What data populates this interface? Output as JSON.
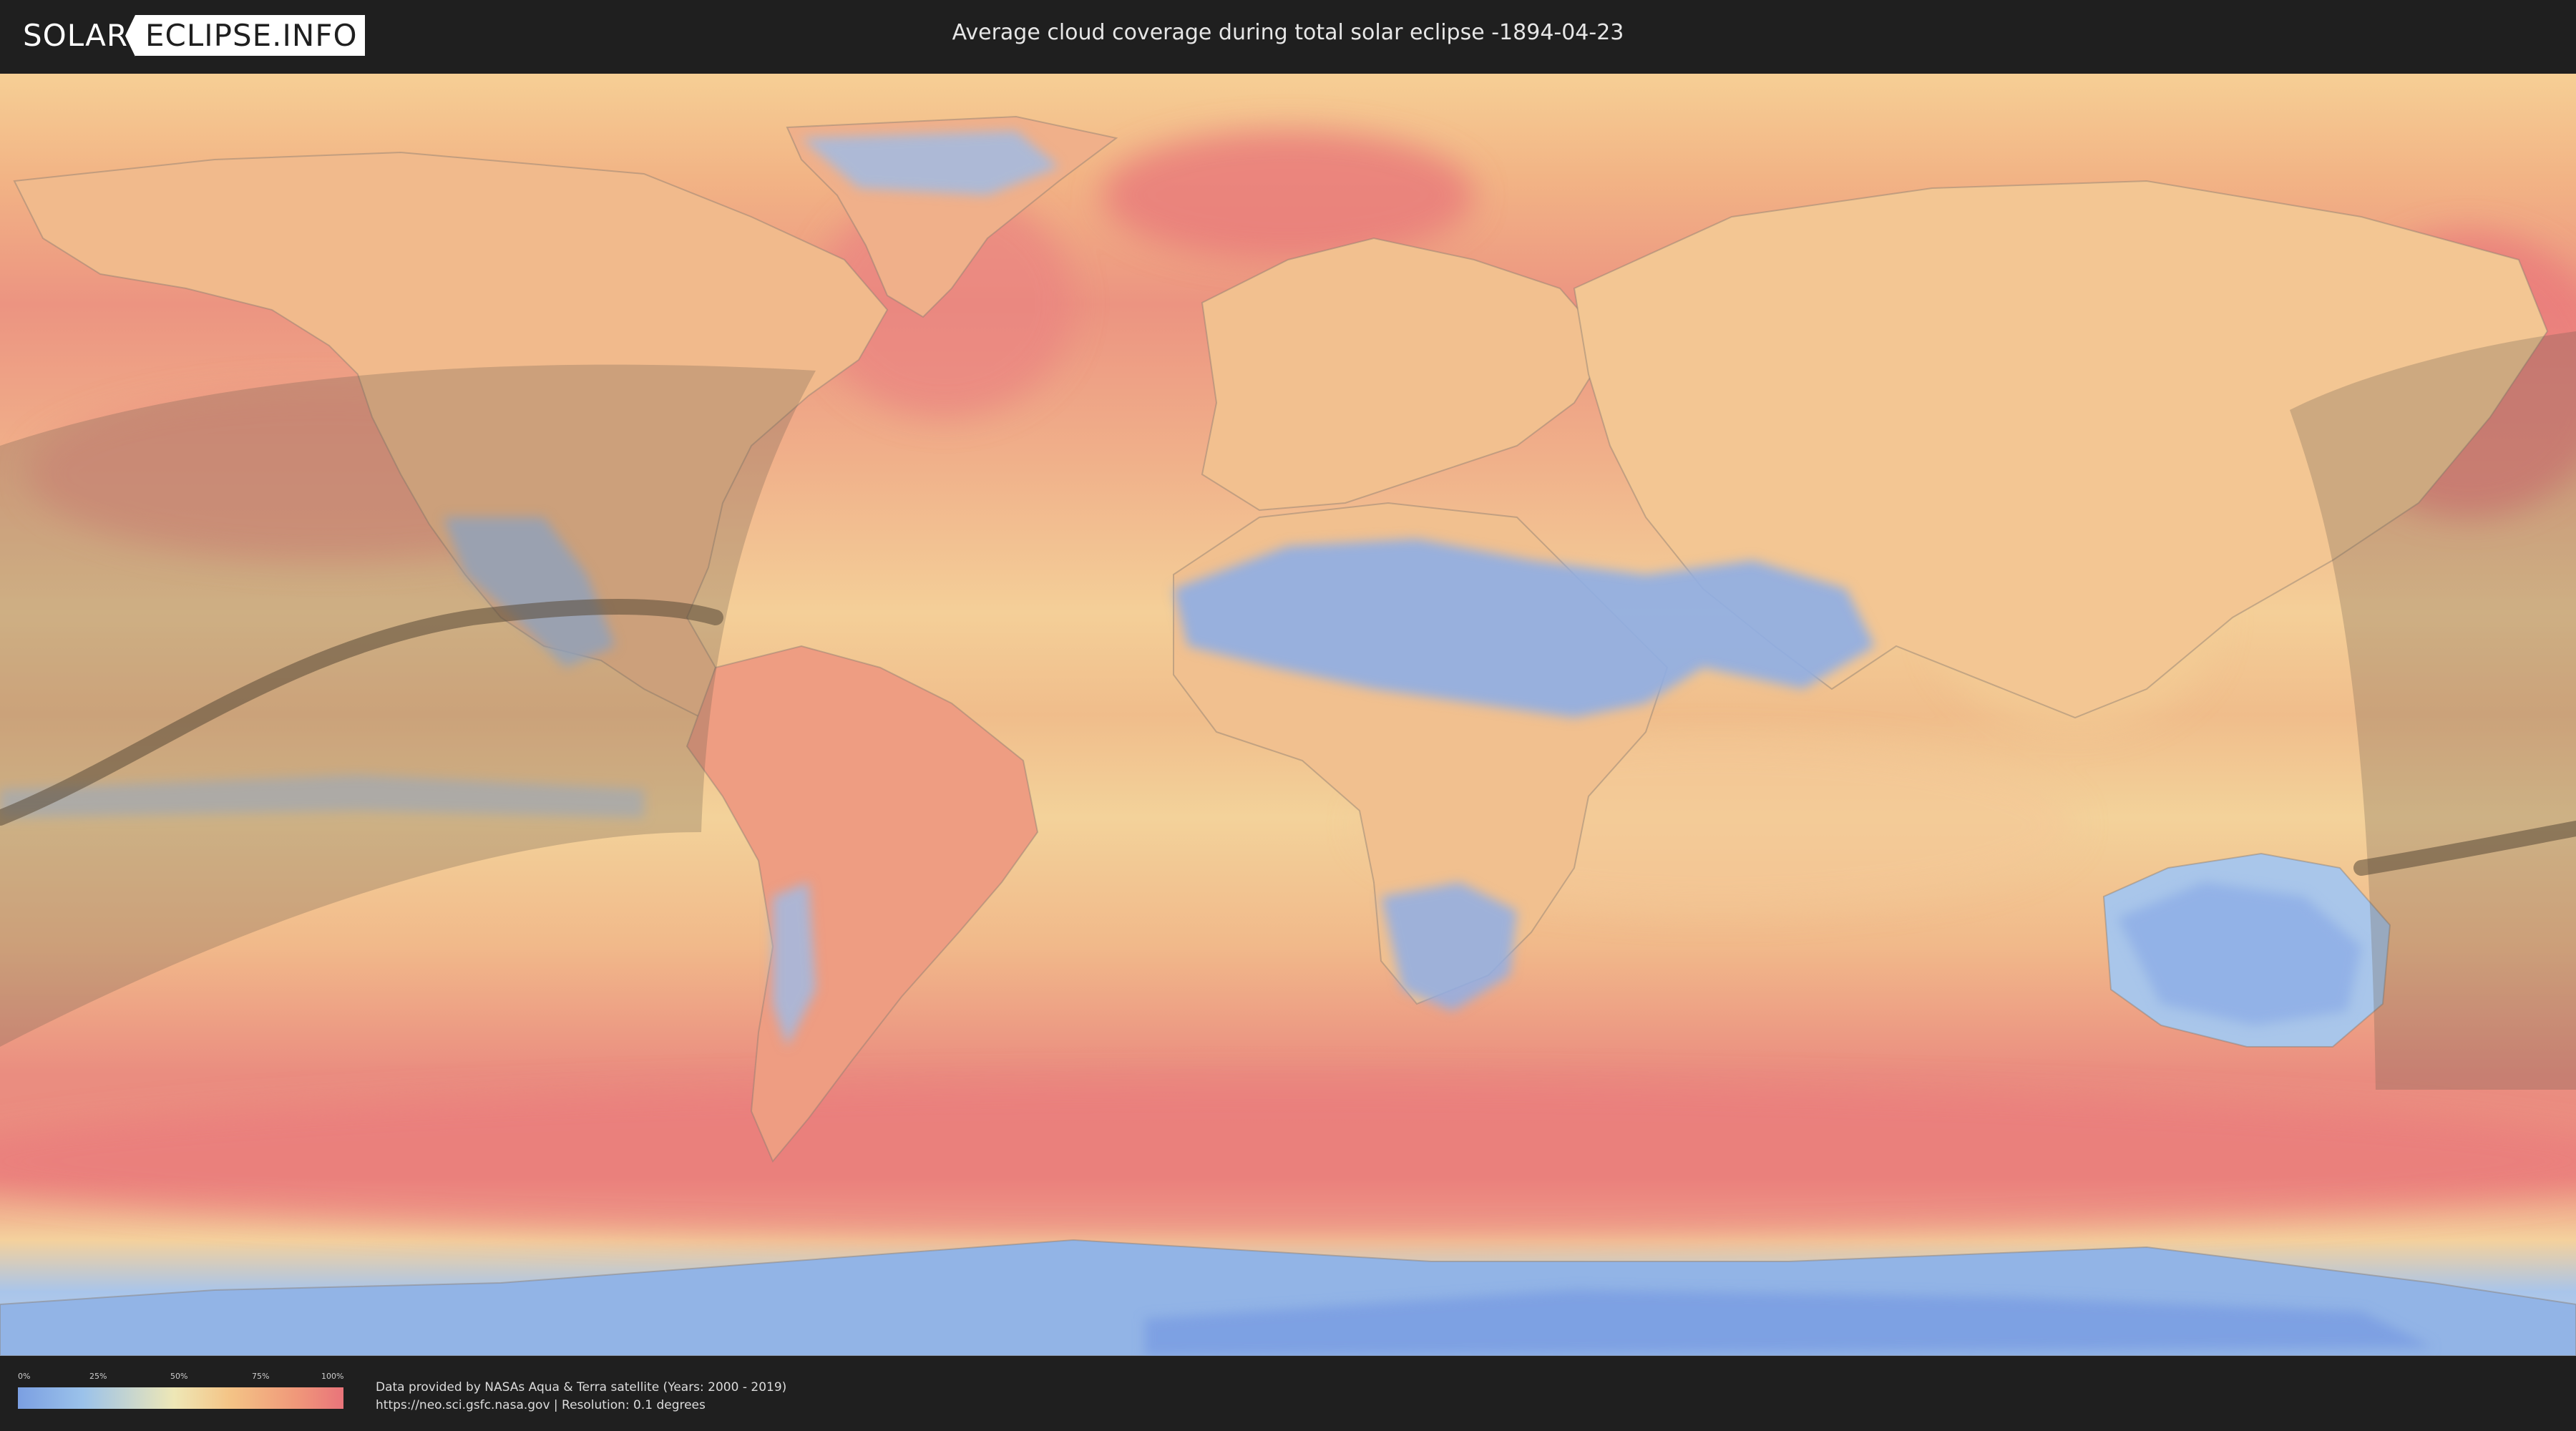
{
  "header": {
    "logo_left": "SOLAR",
    "logo_right": "ECLIPSE.INFO",
    "title": "Average cloud coverage during total solar eclipse -1894-04-23"
  },
  "map": {
    "colors": {
      "clear": "#7b9fe2",
      "low": "#9bc2ea",
      "mid": "#eee7b6",
      "high": "#f4c486",
      "overcast": "#e9747a",
      "eclipse_path": "#5a4a38"
    }
  },
  "legend": {
    "ticks": [
      "0%",
      "25%",
      "50%",
      "75%",
      "100%"
    ]
  },
  "footer": {
    "credit_line_1": "Data provided by NASAs Aqua & Terra satellite (Years: 2000 - 2019)",
    "credit_line_2": "https://neo.sci.gsfc.nasa.gov | Resolution: 0.1 degrees"
  }
}
